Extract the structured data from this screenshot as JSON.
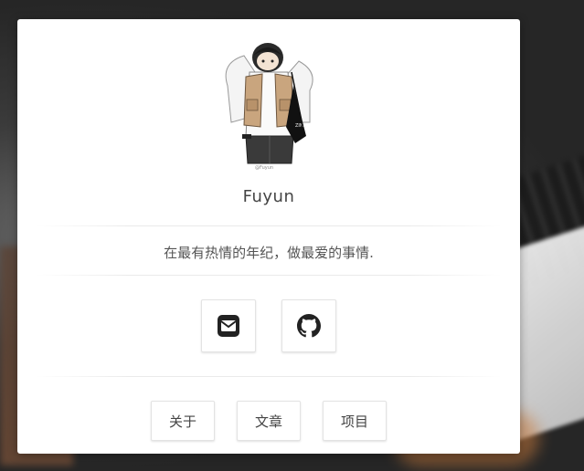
{
  "profile": {
    "name": "Fuyun",
    "motto": "在最有热情的年纪，做最爱的事情.",
    "avatar_signature": "@Fuyun"
  },
  "social": [
    {
      "icon": "envelope-icon",
      "label": "Email"
    },
    {
      "icon": "github-icon",
      "label": "GitHub"
    }
  ],
  "nav": {
    "about": "关于",
    "posts": "文章",
    "projects": "项目"
  }
}
